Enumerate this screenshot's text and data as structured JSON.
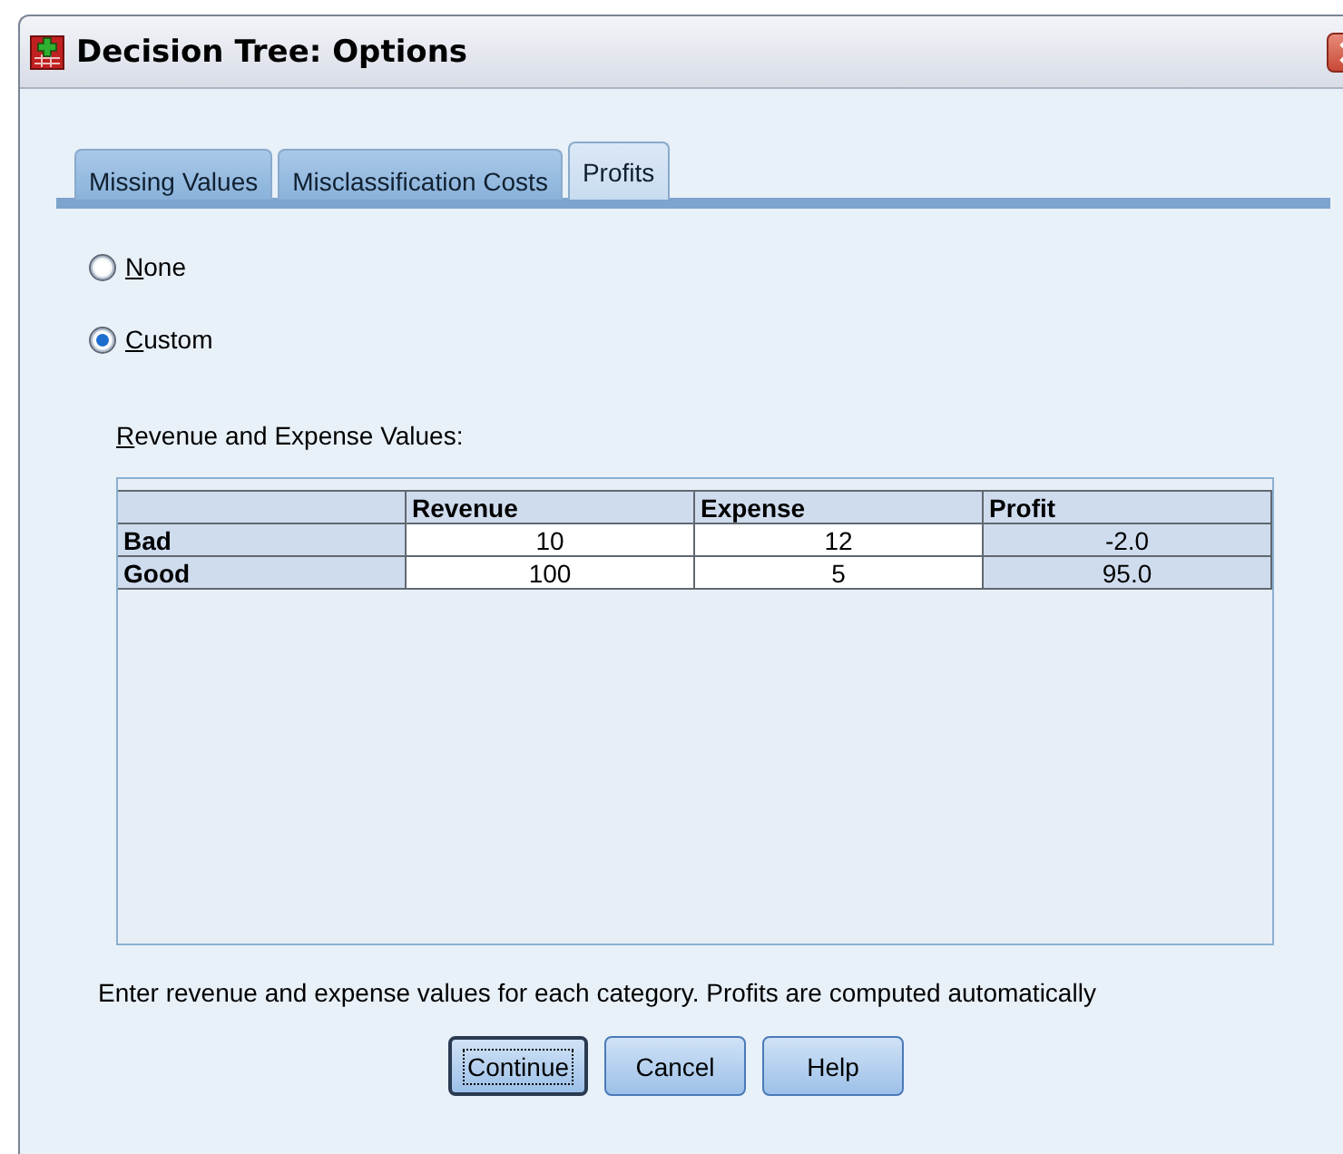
{
  "window": {
    "title": "Decision Tree: Options"
  },
  "tabs": [
    {
      "label": "Missing Values",
      "selected": false
    },
    {
      "label": "Misclassification Costs",
      "selected": false
    },
    {
      "label": "Profits",
      "selected": true
    }
  ],
  "radios": [
    {
      "label": "None",
      "selected": false
    },
    {
      "label": "Custom",
      "selected": true
    }
  ],
  "table": {
    "label": "Revenue and Expense Values:",
    "columns": [
      "Revenue",
      "Expense",
      "Profit"
    ],
    "rows": [
      {
        "category": "Bad",
        "cells": [
          "10",
          "12",
          "-2.0"
        ]
      },
      {
        "category": "Good",
        "cells": [
          "100",
          "5",
          "95.0"
        ]
      }
    ]
  },
  "hint": "Enter revenue and expense values for each category. Profits are computed automatically",
  "buttons": [
    {
      "label": "Continue",
      "default": true
    },
    {
      "label": "Cancel",
      "default": false
    },
    {
      "label": "Help",
      "default": false
    }
  ]
}
